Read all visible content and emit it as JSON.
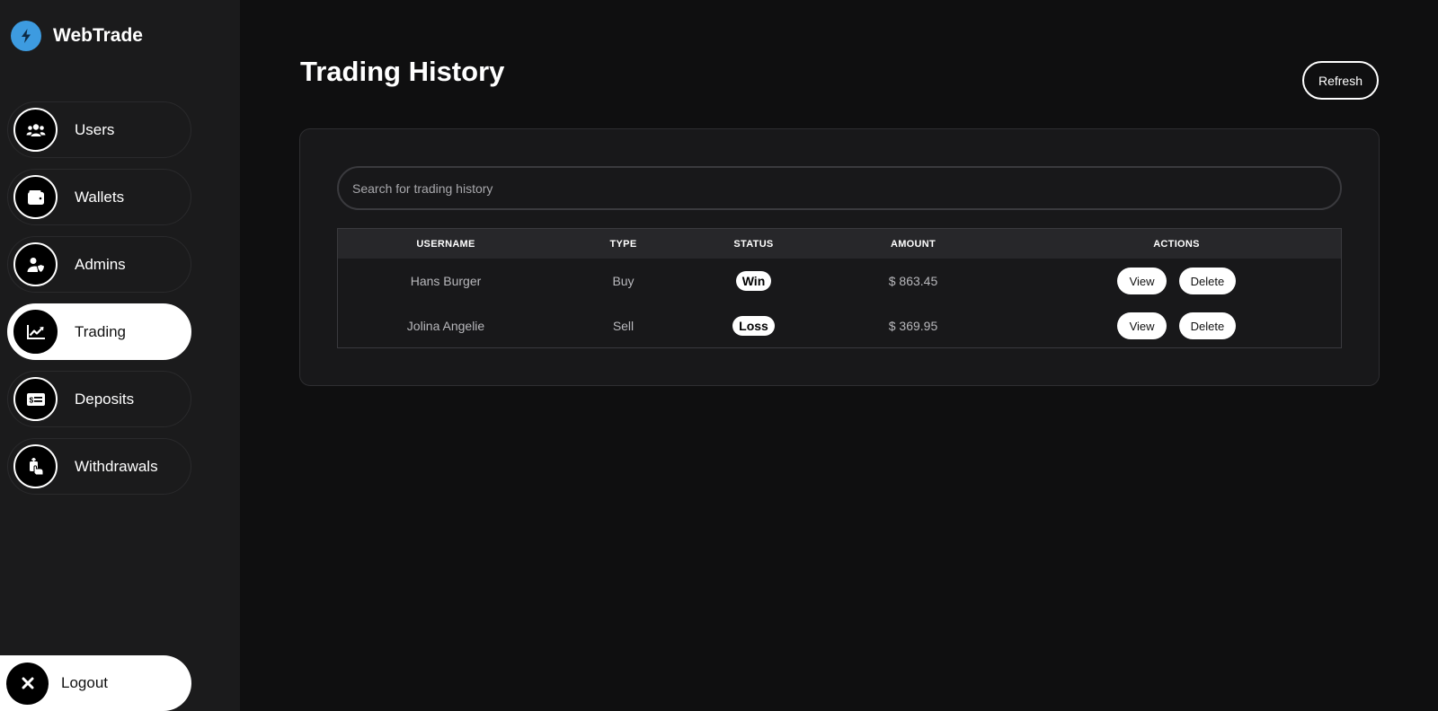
{
  "brand": {
    "name": "WebTrade",
    "logo_icon": "lightning-icon",
    "logo_color": "#3d9be0"
  },
  "sidebar": {
    "items": [
      {
        "label": "Users",
        "icon": "users-icon",
        "active": false
      },
      {
        "label": "Wallets",
        "icon": "wallet-icon",
        "active": false
      },
      {
        "label": "Admins",
        "icon": "admin-shield-icon",
        "active": false
      },
      {
        "label": "Trading",
        "icon": "chart-line-icon",
        "active": true
      },
      {
        "label": "Deposits",
        "icon": "money-bill-icon",
        "active": false
      },
      {
        "label": "Withdrawals",
        "icon": "withdraw-hand-icon",
        "active": false
      }
    ],
    "logout": {
      "label": "Logout",
      "icon": "close-icon"
    }
  },
  "header": {
    "title": "Trading History",
    "refresh_label": "Refresh"
  },
  "search": {
    "placeholder": "Search for trading history",
    "value": ""
  },
  "table": {
    "columns": [
      "USERNAME",
      "TYPE",
      "STATUS",
      "AMOUNT",
      "ACTIONS"
    ],
    "rows": [
      {
        "username": "Hans Burger",
        "type": "Buy",
        "status": "Win",
        "amount": "$ 863.45",
        "view_label": "View",
        "delete_label": "Delete"
      },
      {
        "username": "Jolina Angelie",
        "type": "Sell",
        "status": "Loss",
        "amount": "$ 369.95",
        "view_label": "View",
        "delete_label": "Delete"
      }
    ]
  }
}
